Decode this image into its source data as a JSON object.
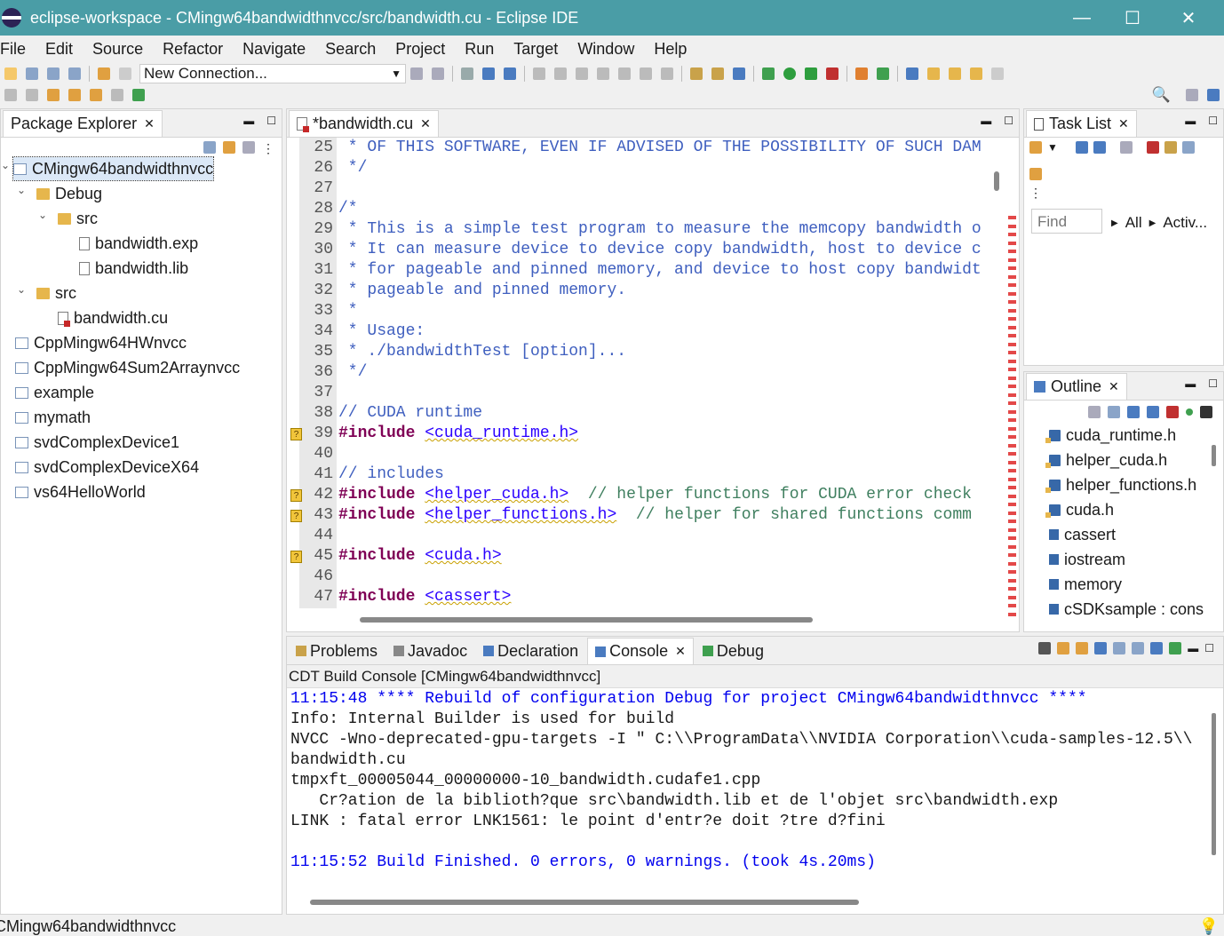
{
  "window": {
    "title": "eclipse-workspace - CMingw64bandwidthnvcc/src/bandwidth.cu - Eclipse IDE",
    "minimize": "—",
    "maximize": "☐",
    "close": "✕"
  },
  "menu": [
    "File",
    "Edit",
    "Source",
    "Refactor",
    "Navigate",
    "Search",
    "Project",
    "Run",
    "Target",
    "Window",
    "Help"
  ],
  "toolbar": {
    "connection": "New Connection..."
  },
  "package_explorer": {
    "tab": "Package Explorer",
    "items": [
      {
        "label": "CMingw64bandwidthnvcc",
        "icon": "project-icon",
        "selected": true
      },
      {
        "label": "Debug",
        "icon": "folder-icon"
      },
      {
        "label": "src",
        "icon": "folder-icon"
      },
      {
        "label": "bandwidth.exp",
        "icon": "exp-file-icon"
      },
      {
        "label": "bandwidth.lib",
        "icon": "lib-file-icon"
      },
      {
        "label": "src",
        "icon": "source-folder-icon"
      },
      {
        "label": "bandwidth.cu",
        "icon": "cu-file-icon"
      },
      {
        "label": "CppMingw64HWnvcc",
        "icon": "project-icon"
      },
      {
        "label": "CppMingw64Sum2Arraynvcc",
        "icon": "project-icon"
      },
      {
        "label": "example",
        "icon": "project-icon"
      },
      {
        "label": "mymath",
        "icon": "project-icon"
      },
      {
        "label": "svdComplexDevice1",
        "icon": "project-icon"
      },
      {
        "label": "svdComplexDeviceX64",
        "icon": "project-icon"
      },
      {
        "label": "vs64HelloWorld",
        "icon": "project-icon"
      }
    ]
  },
  "editor": {
    "tab": "*bandwidth.cu",
    "lines": [
      {
        "n": "25",
        "t": " * OF THIS SOFTWARE, EVEN IF ADVISED OF THE POSSIBILITY OF SUCH DAM"
      },
      {
        "n": "26",
        "t": " */"
      },
      {
        "n": "27",
        "t": ""
      },
      {
        "n": "28",
        "t": "/*"
      },
      {
        "n": "29",
        "t": " * This is a simple test program to measure the memcopy bandwidth o"
      },
      {
        "n": "30",
        "t": " * It can measure device to device copy bandwidth, host to device c"
      },
      {
        "n": "31",
        "t": " * for pageable and pinned memory, and device to host copy bandwidt"
      },
      {
        "n": "32",
        "t": " * pageable and pinned memory."
      },
      {
        "n": "33",
        "t": " *"
      },
      {
        "n": "34",
        "t": " * Usage:"
      },
      {
        "n": "35",
        "t": " * ./bandwidthTest [option]..."
      },
      {
        "n": "36",
        "t": " */"
      },
      {
        "n": "37",
        "t": ""
      },
      {
        "n": "38",
        "t": "// CUDA runtime"
      },
      {
        "n": "39",
        "kw": "#include",
        "s": "<cuda_runtime.h>",
        "c": ""
      },
      {
        "n": "40",
        "t": ""
      },
      {
        "n": "41",
        "t": "// includes"
      },
      {
        "n": "42",
        "kw": "#include",
        "s": "<helper_cuda.h>",
        "c": "  // helper functions for CUDA error check"
      },
      {
        "n": "43",
        "kw": "#include",
        "s": "<helper_functions.h>",
        "c": "  // helper for shared functions comm"
      },
      {
        "n": "44",
        "t": ""
      },
      {
        "n": "45",
        "kw": "#include",
        "s": "<cuda.h>",
        "c": ""
      },
      {
        "n": "46",
        "t": ""
      },
      {
        "n": "47",
        "kw": "#include",
        "s": "<cassert>",
        "c": ""
      }
    ]
  },
  "task_list": {
    "tab": "Task List",
    "find_placeholder": "Find",
    "all": "All",
    "activ": "Activ..."
  },
  "outline": {
    "tab": "Outline",
    "items": [
      "cuda_runtime.h",
      "helper_cuda.h",
      "helper_functions.h",
      "cuda.h",
      "cassert",
      "iostream",
      "memory",
      "cSDKsample : cons"
    ]
  },
  "bottom_tabs": [
    "Problems",
    "Javadoc",
    "Declaration",
    "Console",
    "Debug"
  ],
  "console": {
    "title": "CDT Build Console [CMingw64bandwidthnvcc]",
    "lines": [
      {
        "t": "11:15:48 **** Rebuild of configuration Debug for project CMingw64bandwidthnvcc ****",
        "blue": true
      },
      {
        "t": "Info: Internal Builder is used for build",
        "blue": false
      },
      {
        "t": "NVCC -Wno-deprecated-gpu-targets -I \" C:\\\\ProgramData\\\\NVIDIA Corporation\\\\cuda-samples-12.5\\\\",
        "blue": false
      },
      {
        "t": "bandwidth.cu",
        "blue": false
      },
      {
        "t": "tmpxft_00005044_00000000-10_bandwidth.cudafe1.cpp",
        "blue": false
      },
      {
        "t": "   Cr?ation de la biblioth?que src\\bandwidth.lib et de l'objet src\\bandwidth.exp",
        "blue": false
      },
      {
        "t": "LINK : fatal error LNK1561: le point d'entr?e doit ?tre d?fini",
        "blue": false
      },
      {
        "t": "",
        "blue": false
      },
      {
        "t": "11:15:52 Build Finished. 0 errors, 0 warnings. (took 4s.20ms)",
        "blue": true
      }
    ]
  },
  "status": {
    "text": "CMingw64bandwidthnvcc"
  },
  "colors": {
    "title_bar": "#4a9da6",
    "keyword": "#7f0055",
    "string": "#2a00ff",
    "comment": "#3f5fbf",
    "console_blue": "#0000ee"
  }
}
